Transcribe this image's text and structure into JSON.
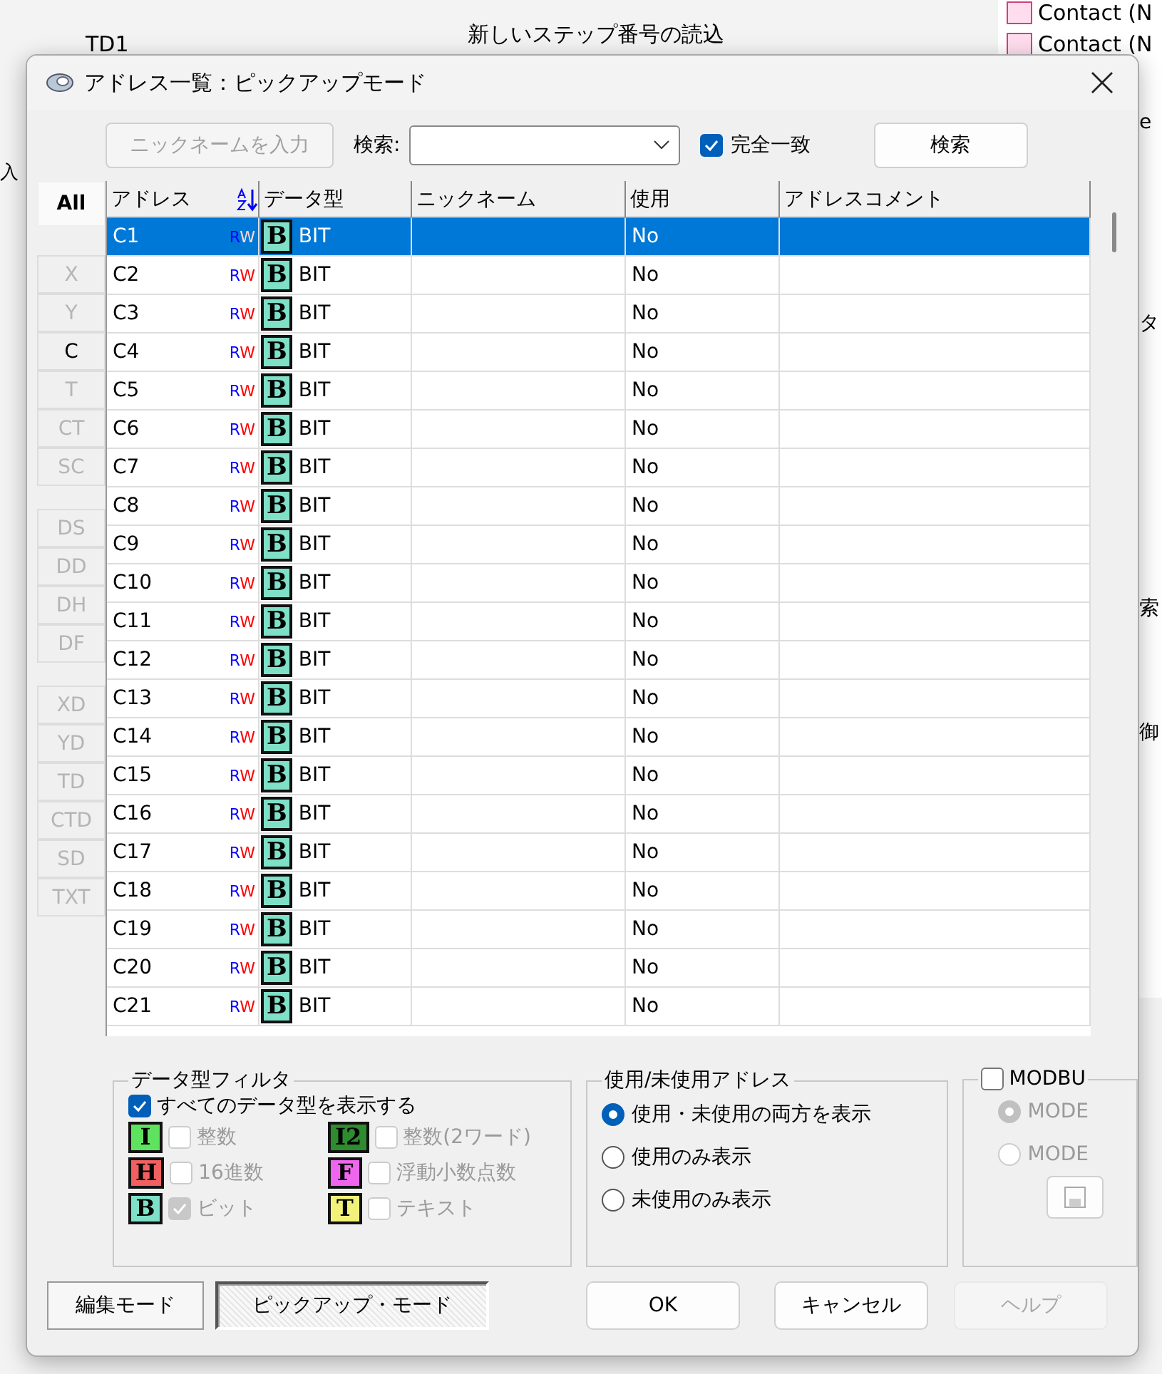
{
  "background": {
    "texts": [
      "TD1",
      "新しいステップ番号の読込",
      "入"
    ],
    "side_items": [
      "Contact (N",
      "Contact (N"
    ],
    "fragments": [
      "e",
      "タ",
      "索",
      "御"
    ]
  },
  "window": {
    "title": "アドレス一覧：ピックアップモード"
  },
  "toolbar": {
    "nickname_button": {
      "label": "ニックネームを入力",
      "disabled": true
    },
    "search_label": "検索:",
    "exact_match": {
      "label": "完全一致",
      "checked": true
    },
    "search_button": "検索"
  },
  "type_buttons": [
    {
      "label": "All",
      "selected": true,
      "disabled": false
    },
    {
      "label": "X",
      "selected": false,
      "disabled": true
    },
    {
      "label": "Y",
      "selected": false,
      "disabled": true
    },
    {
      "label": "C",
      "selected": false,
      "disabled": false
    },
    {
      "label": "T",
      "selected": false,
      "disabled": true
    },
    {
      "label": "CT",
      "selected": false,
      "disabled": true
    },
    {
      "label": "SC",
      "selected": false,
      "disabled": true
    },
    {
      "label": "DS",
      "selected": false,
      "disabled": true
    },
    {
      "label": "DD",
      "selected": false,
      "disabled": true
    },
    {
      "label": "DH",
      "selected": false,
      "disabled": true
    },
    {
      "label": "DF",
      "selected": false,
      "disabled": true
    },
    {
      "label": "XD",
      "selected": false,
      "disabled": true
    },
    {
      "label": "YD",
      "selected": false,
      "disabled": true
    },
    {
      "label": "TD",
      "selected": false,
      "disabled": true
    },
    {
      "label": "CTD",
      "selected": false,
      "disabled": true
    },
    {
      "label": "SD",
      "selected": false,
      "disabled": true
    },
    {
      "label": "TXT",
      "selected": false,
      "disabled": true
    }
  ],
  "table": {
    "columns": [
      "アドレス",
      "データ型",
      "ニックネーム",
      "使用",
      "アドレスコメント"
    ],
    "rows": [
      {
        "address": "C1",
        "access": "RW",
        "badge": "B",
        "type": "BIT",
        "use": "No",
        "selected": true
      },
      {
        "address": "C2",
        "access": "RW",
        "badge": "B",
        "type": "BIT",
        "use": "No",
        "selected": false
      },
      {
        "address": "C3",
        "access": "RW",
        "badge": "B",
        "type": "BIT",
        "use": "No",
        "selected": false
      },
      {
        "address": "C4",
        "access": "RW",
        "badge": "B",
        "type": "BIT",
        "use": "No",
        "selected": false
      },
      {
        "address": "C5",
        "access": "RW",
        "badge": "B",
        "type": "BIT",
        "use": "No",
        "selected": false
      },
      {
        "address": "C6",
        "access": "RW",
        "badge": "B",
        "type": "BIT",
        "use": "No",
        "selected": false
      },
      {
        "address": "C7",
        "access": "RW",
        "badge": "B",
        "type": "BIT",
        "use": "No",
        "selected": false
      },
      {
        "address": "C8",
        "access": "RW",
        "badge": "B",
        "type": "BIT",
        "use": "No",
        "selected": false
      },
      {
        "address": "C9",
        "access": "RW",
        "badge": "B",
        "type": "BIT",
        "use": "No",
        "selected": false
      },
      {
        "address": "C10",
        "access": "RW",
        "badge": "B",
        "type": "BIT",
        "use": "No",
        "selected": false
      },
      {
        "address": "C11",
        "access": "RW",
        "badge": "B",
        "type": "BIT",
        "use": "No",
        "selected": false
      },
      {
        "address": "C12",
        "access": "RW",
        "badge": "B",
        "type": "BIT",
        "use": "No",
        "selected": false
      },
      {
        "address": "C13",
        "access": "RW",
        "badge": "B",
        "type": "BIT",
        "use": "No",
        "selected": false
      },
      {
        "address": "C14",
        "access": "RW",
        "badge": "B",
        "type": "BIT",
        "use": "No",
        "selected": false
      },
      {
        "address": "C15",
        "access": "RW",
        "badge": "B",
        "type": "BIT",
        "use": "No",
        "selected": false
      },
      {
        "address": "C16",
        "access": "RW",
        "badge": "B",
        "type": "BIT",
        "use": "No",
        "selected": false
      },
      {
        "address": "C17",
        "access": "RW",
        "badge": "B",
        "type": "BIT",
        "use": "No",
        "selected": false
      },
      {
        "address": "C18",
        "access": "RW",
        "badge": "B",
        "type": "BIT",
        "use": "No",
        "selected": false
      },
      {
        "address": "C19",
        "access": "RW",
        "badge": "B",
        "type": "BIT",
        "use": "No",
        "selected": false
      },
      {
        "address": "C20",
        "access": "RW",
        "badge": "B",
        "type": "BIT",
        "use": "No",
        "selected": false
      },
      {
        "address": "C21",
        "access": "RW",
        "badge": "B",
        "type": "BIT",
        "use": "No",
        "selected": false
      }
    ]
  },
  "data_type_filter": {
    "title": "データ型フィルタ",
    "show_all": {
      "label": "すべてのデータ型を表示する",
      "checked": true
    },
    "items": [
      {
        "badge": "I",
        "label": "整数",
        "checked": false,
        "disabled": true,
        "color": "#5fe35f"
      },
      {
        "badge": "I2",
        "label": "整数(2ワード)",
        "checked": false,
        "disabled": true,
        "color": "#2e8b2e"
      },
      {
        "badge": "H",
        "label": "16進数",
        "checked": false,
        "disabled": true,
        "color": "#f06060"
      },
      {
        "badge": "F",
        "label": "浮動小数点数",
        "checked": false,
        "disabled": true,
        "color": "#ee66ee"
      },
      {
        "badge": "B",
        "label": "ビット",
        "checked": true,
        "disabled": true,
        "color": "#7fe0c8"
      },
      {
        "badge": "T",
        "label": "テキスト",
        "checked": false,
        "disabled": true,
        "color": "#f2f27a"
      }
    ]
  },
  "usage_filter": {
    "title": "使用/未使用アドレス",
    "options": [
      {
        "label": "使用・未使用の両方を表示",
        "selected": true
      },
      {
        "label": "使用のみ表示",
        "selected": false
      },
      {
        "label": "未使用のみ表示",
        "selected": false
      }
    ]
  },
  "modbus": {
    "label": "MODBU",
    "checked": false,
    "options": [
      {
        "label": "MODE",
        "selected": true
      },
      {
        "label": "MODE",
        "selected": false
      }
    ]
  },
  "buttons": [
    {
      "label": "編集モード",
      "kind": "mode",
      "selected": false,
      "disabled": false
    },
    {
      "label": "ピックアップ・モード",
      "kind": "mode",
      "selected": true,
      "disabled": false
    },
    {
      "label": "OK",
      "kind": "action",
      "selected": false,
      "disabled": false
    },
    {
      "label": "キャンセル",
      "kind": "action",
      "selected": false,
      "disabled": false
    },
    {
      "label": "ヘルプ",
      "kind": "action",
      "selected": false,
      "disabled": true
    }
  ]
}
